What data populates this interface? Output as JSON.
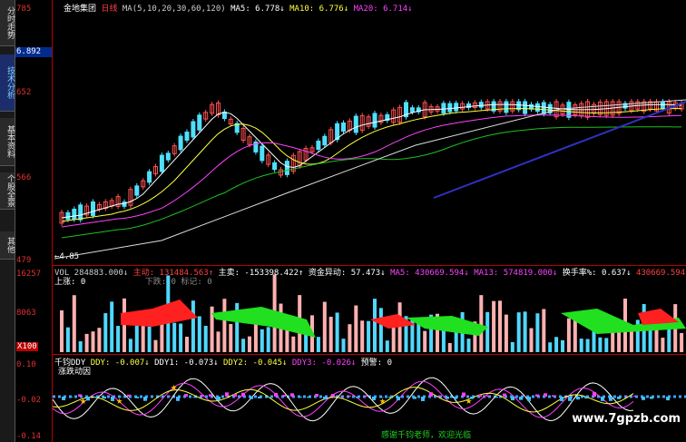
{
  "sidebar": {
    "tabs": [
      {
        "label": "分时走势",
        "active": false
      },
      {
        "label": "技术分析",
        "active": true
      },
      {
        "label": "基本资料",
        "active": false
      },
      {
        "label": "个股全景",
        "active": false
      },
      {
        "label": "其他",
        "active": false
      }
    ]
  },
  "price_axis": {
    "top_label": "785",
    "current_price": "6.892",
    "labels": [
      "652",
      "566",
      "479"
    ]
  },
  "volume_axis": {
    "labels": [
      "16257",
      "8063",
      "X100"
    ]
  },
  "indicator_axis": {
    "labels": [
      "0.10",
      "-0.02",
      "-0.14"
    ]
  },
  "price_header": {
    "stock_name": "金地集团",
    "period": "日线",
    "ma_params": "MA(5,10,20,30,60,120)",
    "ma5": "MA5: 6.778↓",
    "ma10": "MA10: 6.776↓",
    "ma20": "MA20: 6.714↓",
    "low_mark": "←4.85"
  },
  "volume_header": {
    "vol": "VOL 284883.000↓",
    "main_force": "主动: 131484.563↑",
    "main_sell": "主卖: -153398.422↑",
    "capital": "资金异动: 57.473↓",
    "ma5": "MA5: 430669.594↓",
    "ma13": "MA13: 574819.000↓",
    "turnover": "换手率%: 0.637↓",
    "extra": "430669.594↓",
    "up_label": "上涨: 0",
    "down_label": "下跌: 0",
    "mark_label": "标记: 0"
  },
  "indicator_header": {
    "title": "千钧DDY",
    "ddy": "DDY: -0.007↓",
    "ddy1": "DDY1: -0.073↓",
    "ddy2": "DDY2: -0.045↓",
    "ddy3": "DDY3: -0.026↓",
    "warning": "预警: 0",
    "subtitle": "涨跌动因"
  },
  "watermark": "www.7gpzb.com",
  "footer_note": "感谢千钧老师，欢迎光临",
  "colors": {
    "up_candle": "#ff5050",
    "down_candle": "#50e0ff",
    "ma5": "#ffffff",
    "ma10": "#ffff40",
    "ma20": "#ff40ff",
    "axis_red": "#e03030"
  },
  "chart_data": {
    "type": "line",
    "title": "金地集团 日线",
    "y_range_price": [
      4.79,
      7.85
    ],
    "y_range_volume": [
      0,
      16257
    ],
    "y_range_indicator": [
      -0.14,
      0.1
    ],
    "series": [
      {
        "name": "MA5",
        "values": [
          6.778
        ]
      },
      {
        "name": "MA10",
        "values": [
          6.776
        ]
      },
      {
        "name": "MA20",
        "values": [
          6.714
        ]
      }
    ]
  }
}
